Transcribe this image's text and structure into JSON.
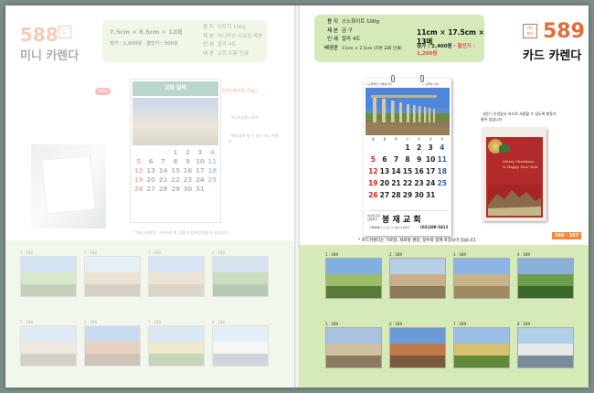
{
  "left_page": {
    "product_number": "588",
    "badge": "미니 카렌다",
    "title": "미니 카렌다",
    "size": "7.5cm × 8.5cm × 12매",
    "price_line": "정가 : 1,800원 · 할인가 : 900원",
    "spec_rows": [
      {
        "k": "용 지",
        "v": "아트지 150g"
      },
      {
        "k": "제 본",
        "v": "미니탁상 스프링 제본"
      },
      {
        "k": "인 쇄",
        "v": "칼라 4도"
      },
      {
        "k": "배 경",
        "v": "교회 이름 인쇄"
      }
    ],
    "callout_small": "588번",
    "callout_text": "스티커(벽부착 가능)",
    "note_1": "· 미니탁상형 디자인",
    "note_2": "· 벽에 붙여 쓸 수 있는 미니 카렌다",
    "church_header": "교회 달력",
    "calendar_numbers": [
      "",
      "",
      "",
      "1",
      "2",
      "3",
      "4",
      "5",
      "6",
      "7",
      "8",
      "9",
      "10",
      "11",
      "12",
      "13",
      "14",
      "15",
      "16",
      "17",
      "18",
      "19",
      "20",
      "21",
      "22",
      "23",
      "24",
      "25",
      "26",
      "27",
      "28",
      "29",
      "30",
      "31",
      "",
      ""
    ],
    "footnote": "* 미니 카렌다는 스티커로 벽, 냉장고 등에 부착할 수 있습니다.",
    "thumbs": [
      {
        "label": "1 · 588"
      },
      {
        "label": "2 · 588"
      },
      {
        "label": "3 · 588"
      },
      {
        "label": "4 · 588"
      },
      {
        "label": "5 · 588"
      },
      {
        "label": "6 · 588"
      },
      {
        "label": "7 · 588"
      },
      {
        "label": "8 · 588"
      }
    ]
  },
  "right_page": {
    "product_number": "589",
    "badge": "카드 형식",
    "title": "카드 카렌다",
    "spec_rows": [
      {
        "k": "용 지",
        "v": "스노화이트 100g"
      },
      {
        "k": "제 본",
        "v": "금 구"
      },
      {
        "k": "인 쇄",
        "v": "칼라 4도"
      },
      {
        "k": "배경판",
        "v": "11cm × 2.5cm (기본 교회 인쇄)"
      }
    ],
    "size": "11cm × 17.5cm × 13매",
    "price_regular": "정가 : 2,400원 · ",
    "price_discount": "할인가 : 1,200원",
    "cal_caption_left": "1 교회명만 인쇄됩니다",
    "cal_caption_right": "1 교회명 인쇄",
    "weekdays": [
      "일",
      "월",
      "화",
      "수",
      "목",
      "금",
      "토"
    ],
    "calendar_numbers": [
      "",
      "",
      "",
      "1",
      "2",
      "3",
      "4",
      "5",
      "6",
      "7",
      "8",
      "9",
      "10",
      "11",
      "12",
      "13",
      "14",
      "15",
      "16",
      "17",
      "18",
      "19",
      "20",
      "21",
      "22",
      "23",
      "24",
      "25",
      "26",
      "27",
      "28",
      "29",
      "30",
      "31",
      "",
      ""
    ],
    "church_small": "새소망교회 담임목사",
    "church_name": "봉 재 교 회",
    "church_address": "서울특별시 ○○구 ○○동 123번지",
    "church_phone": "(02)288-5412",
    "card_note": "· 성탄 / 신년감사 카드로 사용할 수 있도록 봉투가 들어 있습니다",
    "card_text_1": "Merry Christmas",
    "card_text_2": "& Happy New Year",
    "footnote": "* 카드카렌다는 가로형, 세로형 겸용, 봉투와 함께 포장되어 있습니다.",
    "page_number": "166 · 167",
    "thumbs": [
      {
        "label": "1 · 589"
      },
      {
        "label": "2 · 589"
      },
      {
        "label": "3 · 589"
      },
      {
        "label": "4 · 589"
      },
      {
        "label": "5 · 589"
      },
      {
        "label": "6 · 589"
      },
      {
        "label": "7 · 589"
      },
      {
        "label": "8 · 589"
      }
    ]
  },
  "colors": {
    "accent_orange": "#e46c38",
    "spec_green": "#d5eab8",
    "band_green": "#d8ebc4",
    "sunday_red": "#d22"
  }
}
